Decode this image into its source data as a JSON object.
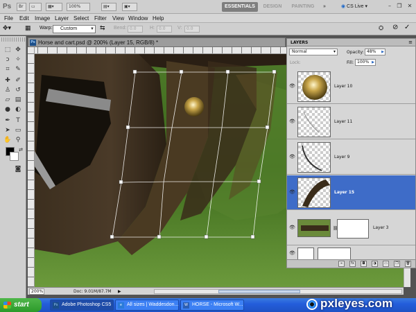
{
  "app": {
    "logo": "Ps",
    "zoom_select": "100%",
    "workspaces": [
      "ESSENTIALS",
      "DESIGN",
      "PAINTING"
    ],
    "more": "»",
    "cslive": "CS Live"
  },
  "menu": [
    "File",
    "Edit",
    "Image",
    "Layer",
    "Select",
    "Filter",
    "View",
    "Window",
    "Help"
  ],
  "options": {
    "warp_label": "Warp:",
    "warp_value": "Custom",
    "bend_label": "Bend:",
    "bend_value": "0.0",
    "h_label": "H:",
    "h_value": "0.0",
    "v_label": "V:",
    "v_value": "0.0"
  },
  "document": {
    "title": "Horse and cart.psd @ 200% (Layer 15, RGB/8) *",
    "zoom": "200%",
    "doc_size": "Doc: 9.01M/87.7M"
  },
  "layers": {
    "panel_title": "LAYERS",
    "blend_mode": "Normal",
    "opacity_label": "Opacity:",
    "opacity_value": "48%",
    "lock_label": "Lock:",
    "fill_label": "Fill:",
    "fill_value": "100%",
    "items": [
      {
        "name": "Layer 10",
        "selected": false
      },
      {
        "name": "Layer 11",
        "selected": false
      },
      {
        "name": "Layer 9",
        "selected": false
      },
      {
        "name": "Layer 15",
        "selected": true
      },
      {
        "name": "Layer 3",
        "selected": false
      }
    ]
  },
  "taskbar": {
    "start": "start",
    "buttons": [
      "Adobe Photoshop CS5",
      "All sizes | Waddesdon...",
      "HORSE - Microsoft W..."
    ]
  },
  "watermark": "pxleyes.com",
  "colors": {
    "accent_selected": "#3e6cc8",
    "taskbar": "#245edb"
  }
}
